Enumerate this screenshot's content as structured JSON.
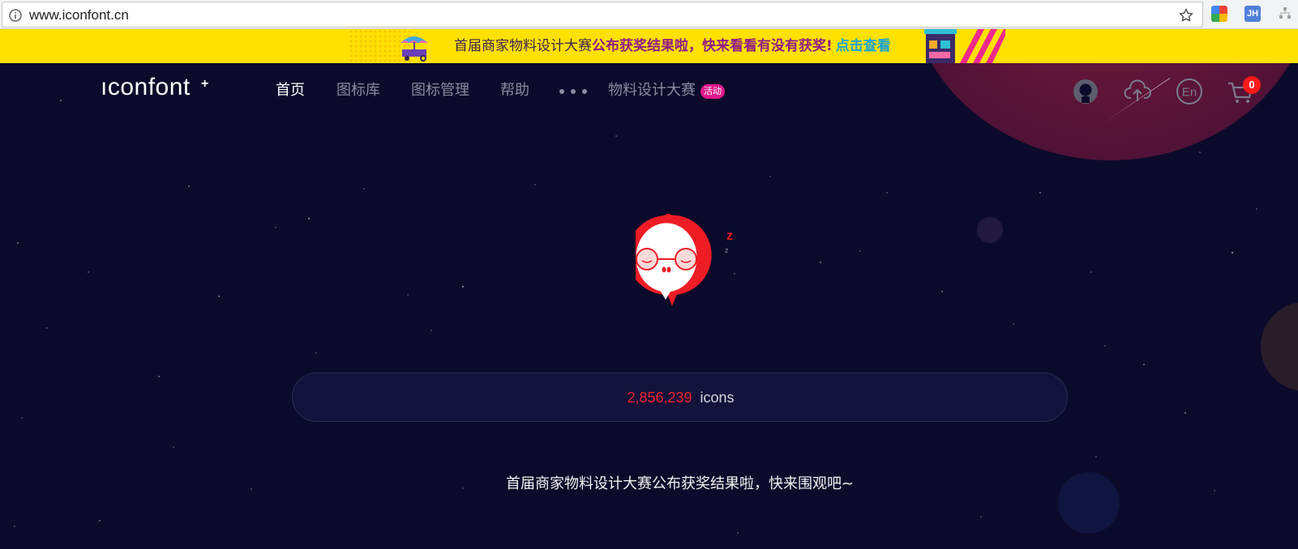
{
  "browser": {
    "url": "www.iconfont.cn",
    "extensions": [
      "color-grid-extension-icon",
      "jh-extension-icon",
      "tree-extension-icon"
    ],
    "ext_jh_label": "JH"
  },
  "promo": {
    "text_plain": "首届商家物料设计大赛",
    "text_highlight": "公布获奖结果啦，快来看看有没有获奖!",
    "link": "点击查看"
  },
  "nav": {
    "logo": "ıconfont",
    "logo_plus": "+",
    "items": [
      {
        "label": "首页",
        "active": true
      },
      {
        "label": "图标库",
        "active": false
      },
      {
        "label": "图标管理",
        "active": false
      },
      {
        "label": "帮助",
        "active": false
      }
    ],
    "contest": "物料设计大赛",
    "hot_badge": "活动",
    "lang": "En",
    "cart_count": "0"
  },
  "hero": {
    "icon_count": "2,856,239",
    "icon_unit": "icons",
    "tagline": "首届商家物料设计大赛公布获奖结果啦，快来围观吧~",
    "sleep_z_big": "z",
    "sleep_z_small": "z"
  },
  "colors": {
    "background": "#0c0a2a",
    "banner": "#ffe100",
    "accent_red": "#e8252b",
    "badge_pink": "#e0188a"
  }
}
